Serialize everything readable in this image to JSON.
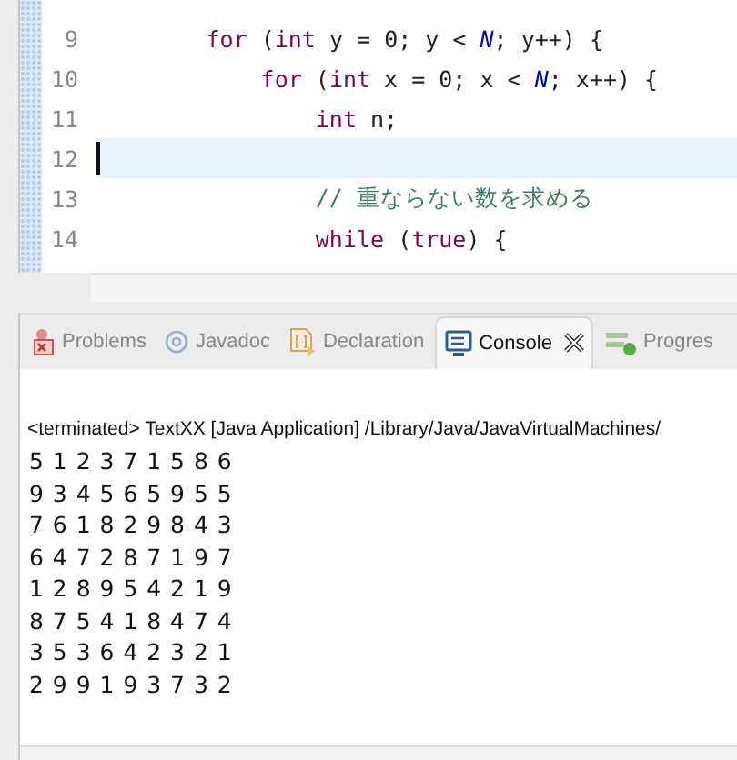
{
  "editor": {
    "lines": [
      {
        "number": "9",
        "current": false,
        "tokens": [
          {
            "kind": "keyword",
            "text": "        for"
          },
          {
            "kind": "plain",
            "text": " ("
          },
          {
            "kind": "keyword",
            "text": "int"
          },
          {
            "kind": "plain",
            "text": " y = 0; y < "
          },
          {
            "kind": "constant",
            "text": "N"
          },
          {
            "kind": "plain",
            "text": "; y++) {"
          }
        ]
      },
      {
        "number": "10",
        "current": false,
        "tokens": [
          {
            "kind": "keyword",
            "text": "            for"
          },
          {
            "kind": "plain",
            "text": " ("
          },
          {
            "kind": "keyword",
            "text": "int"
          },
          {
            "kind": "plain",
            "text": " x = 0; x < "
          },
          {
            "kind": "constant",
            "text": "N"
          },
          {
            "kind": "plain",
            "text": "; x++) {"
          }
        ]
      },
      {
        "number": "11",
        "current": false,
        "tokens": [
          {
            "kind": "keyword",
            "text": "                int"
          },
          {
            "kind": "plain",
            "text": " n;"
          }
        ]
      },
      {
        "number": "12",
        "current": true
      },
      {
        "number": "13",
        "current": false,
        "tokens": [
          {
            "kind": "comment",
            "text": "                // 重ならない数を求める"
          }
        ]
      },
      {
        "number": "14",
        "current": false,
        "tokens": [
          {
            "kind": "keyword",
            "text": "                while"
          },
          {
            "kind": "plain",
            "text": " ("
          },
          {
            "kind": "keyword",
            "text": "true"
          },
          {
            "kind": "plain",
            "text": ") {"
          }
        ]
      }
    ]
  },
  "tabs": [
    {
      "kind": "problems",
      "label": "Problems",
      "selected": false,
      "closable": false
    },
    {
      "kind": "javadoc",
      "label": "Javadoc",
      "selected": false,
      "closable": false
    },
    {
      "kind": "declaration",
      "label": "Declaration",
      "selected": false,
      "closable": false
    },
    {
      "kind": "console",
      "label": "Console",
      "selected": true,
      "closable": true
    },
    {
      "kind": "progress",
      "label": "Progres",
      "selected": false,
      "closable": false
    }
  ],
  "console": {
    "header": "<terminated> TextXX [Java Application] /Library/Java/JavaVirtualMachines/",
    "output": [
      "5 1 2 3 7 1 5 8 6",
      "9 3 4 5 6 5 9 5 5",
      "7 6 1 8 2 9 8 4 3",
      "6 4 7 2 8 7 1 9 7",
      "1 2 8 9 5 4 2 1 9",
      "8 7 5 4 1 8 4 7 4",
      "3 5 3 6 4 2 3 2 1",
      "2 9 9 1 9 3 7 3 2"
    ]
  }
}
